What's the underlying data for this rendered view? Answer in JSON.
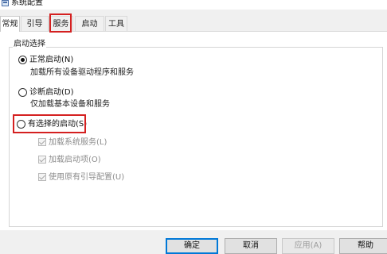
{
  "window": {
    "title": "系统配置"
  },
  "tabs": [
    {
      "label": "常规"
    },
    {
      "label": "引导"
    },
    {
      "label": "服务"
    },
    {
      "label": "启动"
    },
    {
      "label": "工具"
    }
  ],
  "group": {
    "title": "启动选择",
    "options": [
      {
        "label": "正常启动(N)",
        "description": "加载所有设备驱动程序和服务",
        "checked": true
      },
      {
        "label": "诊断启动(D)",
        "description": "仅加载基本设备和服务",
        "checked": false
      },
      {
        "label": "有选择的启动(S)",
        "checked": false
      }
    ],
    "checkboxes": [
      {
        "label": "加载系统服务(L)",
        "checked": true,
        "disabled": true
      },
      {
        "label": "加载启动项(O)",
        "checked": true,
        "disabled": true
      },
      {
        "label": "使用原有引导配置(U)",
        "checked": true,
        "disabled": true
      }
    ]
  },
  "buttons": {
    "ok": "确定",
    "cancel": "取消",
    "apply": "应用(A)",
    "help": "帮助"
  },
  "highlight_color": "#d42020"
}
